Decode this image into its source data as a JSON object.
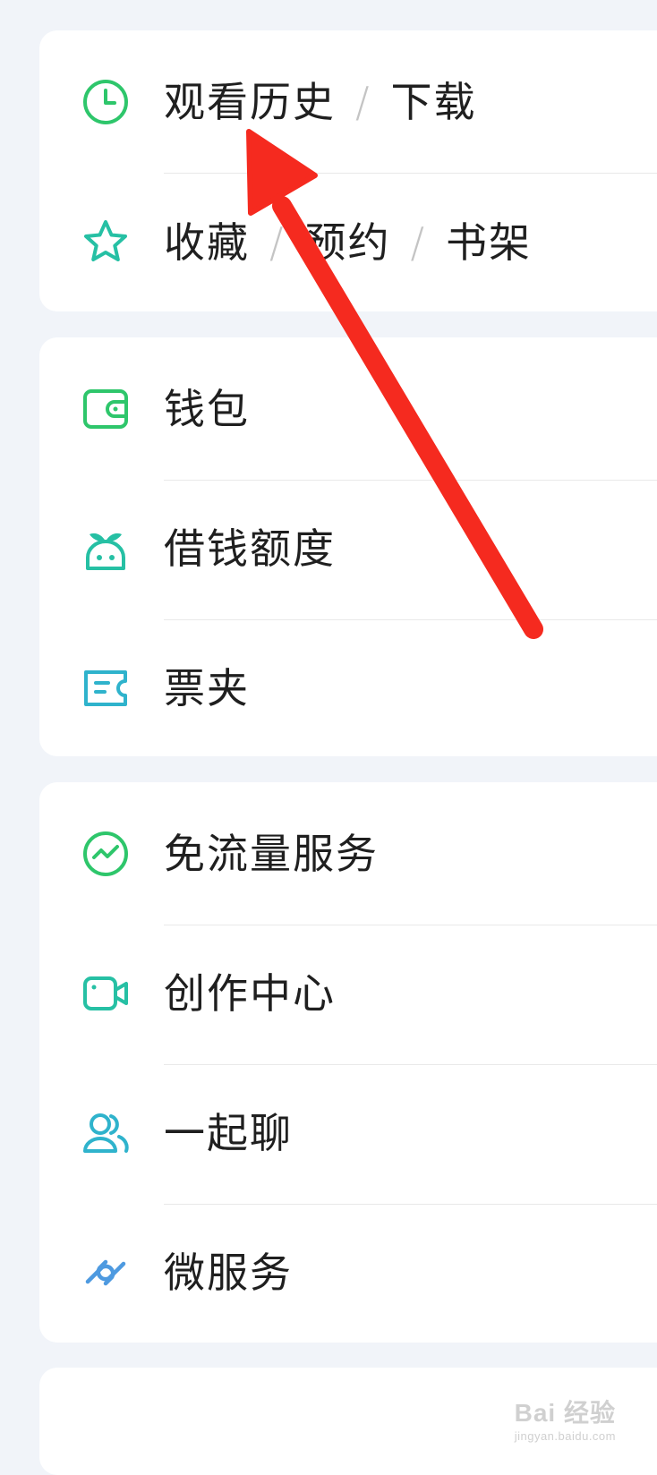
{
  "menu": {
    "card1": {
      "history": {
        "icon": "clock-icon",
        "parts": [
          "观看历史",
          "下载"
        ],
        "separator": "/"
      },
      "favorites": {
        "icon": "star-icon",
        "parts": [
          "收藏",
          "预约",
          "书架"
        ],
        "separator": "/"
      }
    },
    "card2": {
      "wallet": {
        "icon": "wallet-icon",
        "label": "钱包"
      },
      "loan": {
        "icon": "sprout-bot-icon",
        "label": "借钱额度"
      },
      "tickets": {
        "icon": "ticket-icon",
        "label": "票夹"
      }
    },
    "card3": {
      "data_free": {
        "icon": "trend-circle-icon",
        "label": "免流量服务"
      },
      "creator": {
        "icon": "camera-icon",
        "label": "创作中心"
      },
      "chat": {
        "icon": "people-icon",
        "label": "一起聊"
      },
      "micro": {
        "icon": "link-icon",
        "label": "微服务"
      }
    }
  },
  "watermark": {
    "main": "Bai 经验",
    "sub": "jingyan.baidu.com"
  },
  "colors": {
    "green": "#2ec66b",
    "teal": "#26c0a4",
    "cyan": "#2fb3cc",
    "blue": "#4e9ae0",
    "arrow": "#f52a1f",
    "background": "#f1f4f9"
  }
}
